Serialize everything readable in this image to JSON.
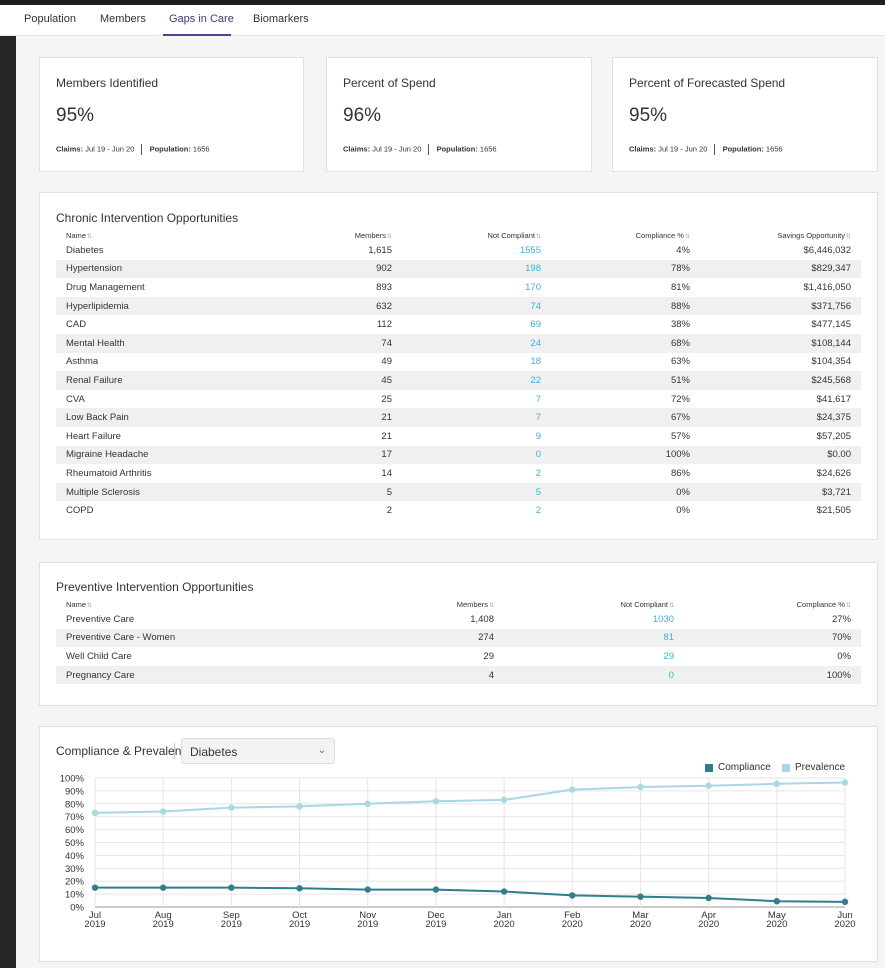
{
  "tabs": [
    {
      "label": "Population",
      "active": false
    },
    {
      "label": "Members",
      "active": false
    },
    {
      "label": "Gaps in Care",
      "active": true
    },
    {
      "label": "Biomarkers",
      "active": false
    }
  ],
  "kpis": [
    {
      "title": "Members Identified",
      "value": "95%",
      "claims_label": "Claims:",
      "claims_value": "Jul 19 - Jun 20",
      "population_label": "Population:",
      "population_value": "1656"
    },
    {
      "title": "Percent of Spend",
      "value": "96%",
      "claims_label": "Claims:",
      "claims_value": "Jul 19 - Jun 20",
      "population_label": "Population:",
      "population_value": "1656"
    },
    {
      "title": "Percent of Forecasted Spend",
      "value": "95%",
      "claims_label": "Claims:",
      "claims_value": "Jul 19 - Jun 20",
      "population_label": "Population:",
      "population_value": "1656"
    }
  ],
  "chronic": {
    "title": "Chronic Intervention Opportunities",
    "columns": [
      "Name",
      "Members",
      "Not Compliant",
      "Compliance %",
      "Savings Opportunity"
    ],
    "rows": [
      [
        "Diabetes",
        "1,615",
        "1555",
        "4%",
        "$6,446,032"
      ],
      [
        "Hypertension",
        "902",
        "198",
        "78%",
        "$829,347"
      ],
      [
        "Drug Management",
        "893",
        "170",
        "81%",
        "$1,416,050"
      ],
      [
        "Hyperlipidemia",
        "632",
        "74",
        "88%",
        "$371,756"
      ],
      [
        "CAD",
        "112",
        "69",
        "38%",
        "$477,145"
      ],
      [
        "Mental Health",
        "74",
        "24",
        "68%",
        "$108,144"
      ],
      [
        "Asthma",
        "49",
        "18",
        "63%",
        "$104,354"
      ],
      [
        "Renal Failure",
        "45",
        "22",
        "51%",
        "$245,568"
      ],
      [
        "CVA",
        "25",
        "7",
        "72%",
        "$41,617"
      ],
      [
        "Low Back Pain",
        "21",
        "7",
        "67%",
        "$24,375"
      ],
      [
        "Heart Failure",
        "21",
        "9",
        "57%",
        "$57,205"
      ],
      [
        "Migraine Headache",
        "17",
        "0",
        "100%",
        "$0.00"
      ],
      [
        "Rheumatoid Arthritis",
        "14",
        "2",
        "86%",
        "$24,626"
      ],
      [
        "Multiple Sclerosis",
        "5",
        "5",
        "0%",
        "$3,721"
      ],
      [
        "COPD",
        "2",
        "2",
        "0%",
        "$21,505"
      ]
    ]
  },
  "preventive": {
    "title": "Preventive Intervention Opportunities",
    "columns": [
      "Name",
      "Members",
      "Not Compliant",
      "Compliance %"
    ],
    "rows": [
      [
        "Preventive Care",
        "1,408",
        "1030",
        "27%"
      ],
      [
        "Preventive Care - Women",
        "274",
        "81",
        "70%"
      ],
      [
        "Well Child Care",
        "29",
        "29",
        "0%"
      ],
      [
        "Pregnancy Care",
        "4",
        "0",
        "100%"
      ]
    ]
  },
  "compliance_chart": {
    "title": "Compliance & Prevalence",
    "selected_condition": "Diabetes",
    "icons": {
      "dropdown": "chevron-down-icon",
      "sort": "sort-icon"
    }
  },
  "colors": {
    "compliance": "#2f7f8c",
    "prevalence": "#a7d8e4",
    "link": "#3ab0e0",
    "active_tab": "#5a3e8c"
  },
  "chart_data": {
    "type": "line",
    "x": [
      "Jul\n2019",
      "Aug\n2019",
      "Sep\n2019",
      "Oct\n2019",
      "Nov\n2019",
      "Dec\n2019",
      "Jan\n2020",
      "Feb\n2020",
      "Mar\n2020",
      "Apr\n2020",
      "May\n2020",
      "Jun\n2020"
    ],
    "series": [
      {
        "name": "Compliance",
        "values": [
          15,
          15,
          15,
          14.5,
          13.5,
          13.5,
          12,
          9,
          8,
          7,
          4.5,
          4
        ]
      },
      {
        "name": "Prevalence",
        "values": [
          73,
          74,
          77,
          78,
          80,
          82,
          83,
          91,
          93,
          94,
          95.5,
          96.5
        ]
      }
    ],
    "ylim": [
      0,
      100
    ],
    "yticks": [
      "0%",
      "10%",
      "20%",
      "30%",
      "40%",
      "50%",
      "60%",
      "70%",
      "80%",
      "90%",
      "100%"
    ],
    "grid": true,
    "legend": "top-right"
  }
}
